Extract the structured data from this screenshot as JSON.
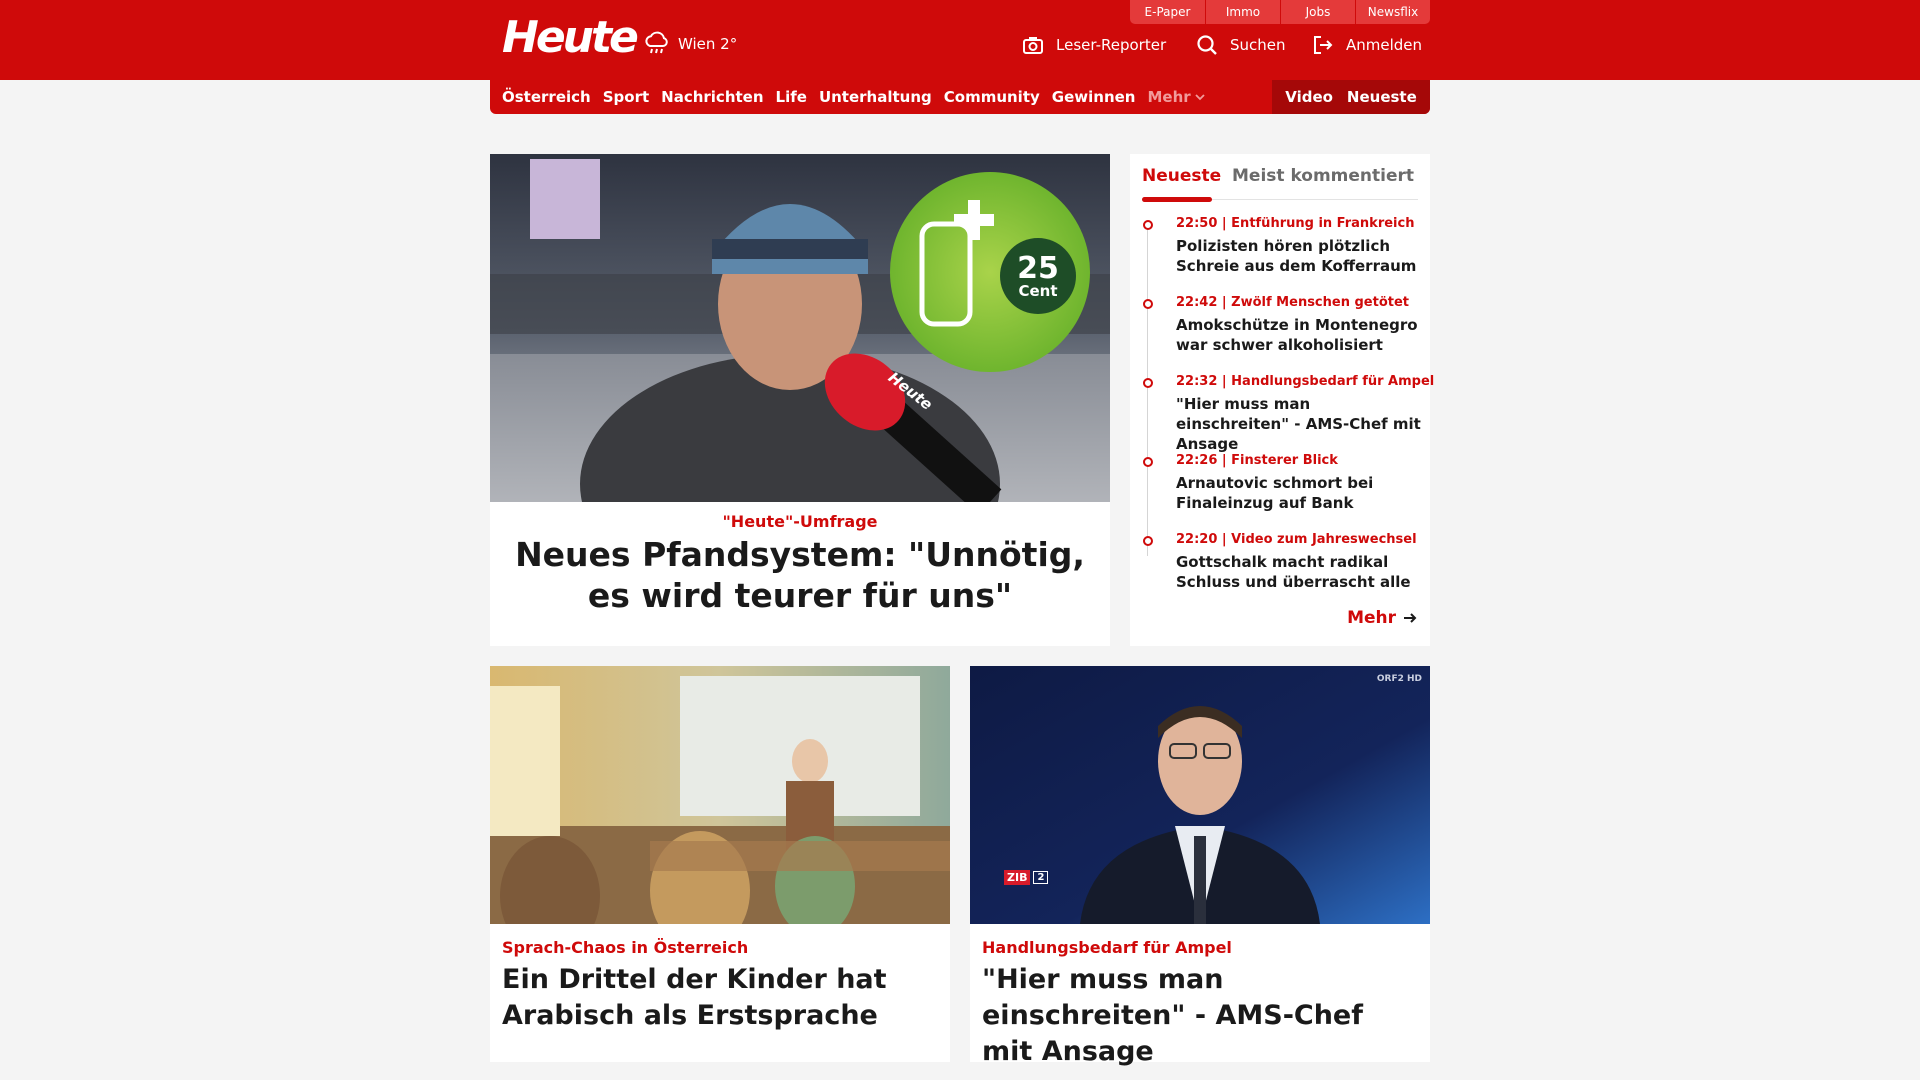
{
  "header": {
    "logo": "Heute",
    "weather": "Wien 2°",
    "external_tabs": [
      "E-Paper",
      "Immo",
      "Jobs",
      "Newsflix"
    ],
    "reporter_label": "Leser-Reporter",
    "search_label": "Suchen",
    "login_label": "Anmelden",
    "brand_color": "#cf0a0a"
  },
  "nav": {
    "items": [
      "Österreich",
      "Sport",
      "Nachrichten",
      "Life",
      "Unterhaltung",
      "Community",
      "Gewinnen"
    ],
    "more_label": "Mehr",
    "video_label": "Video",
    "latest_label": "Neueste"
  },
  "hero": {
    "kicker": "\"Heute\"-Umfrage",
    "title": "Neues Pfandsystem: \"Unnötig, es wird teurer für uns\"",
    "badge_value": "25",
    "badge_unit": "Cent",
    "mic_label": "Heute"
  },
  "sidebar": {
    "tab_active": "Neueste",
    "tab_inactive": "Meist kommentiert",
    "items": [
      {
        "meta": "22:50 | Entführung in Frankreich",
        "headline": "Polizisten hören plötzlich Schreie aus dem Kofferraum"
      },
      {
        "meta": "22:42 | Zwölf Menschen getötet",
        "headline": "Amokschütze in Montenegro war schwer alkoholisiert"
      },
      {
        "meta": "22:32 | Handlungsbedarf für Ampel",
        "headline": "\"Hier muss man einschreiten\" - AMS-Chef mit Ansage"
      },
      {
        "meta": "22:26 | Finsterer Blick",
        "headline": "Arnautovic schmort bei Finaleinzug auf Bank"
      },
      {
        "meta": "22:20 | Video zum Jahreswechsel",
        "headline": "Gottschalk macht radikal Schluss und überrascht alle"
      }
    ],
    "more_label": "Mehr"
  },
  "cards": [
    {
      "kicker": "Sprach-Chaos in Österreich",
      "title": "Ein Drittel der Kinder hat Arabisch als Erstsprache"
    },
    {
      "kicker": "Handlungsbedarf für Ampel",
      "title": "\"Hier muss man einschreiten\" - AMS-Chef mit Ansage",
      "tv_logo": "ZIB",
      "tv_channel": "2",
      "tv_corner": "ORF2 HD"
    }
  ]
}
